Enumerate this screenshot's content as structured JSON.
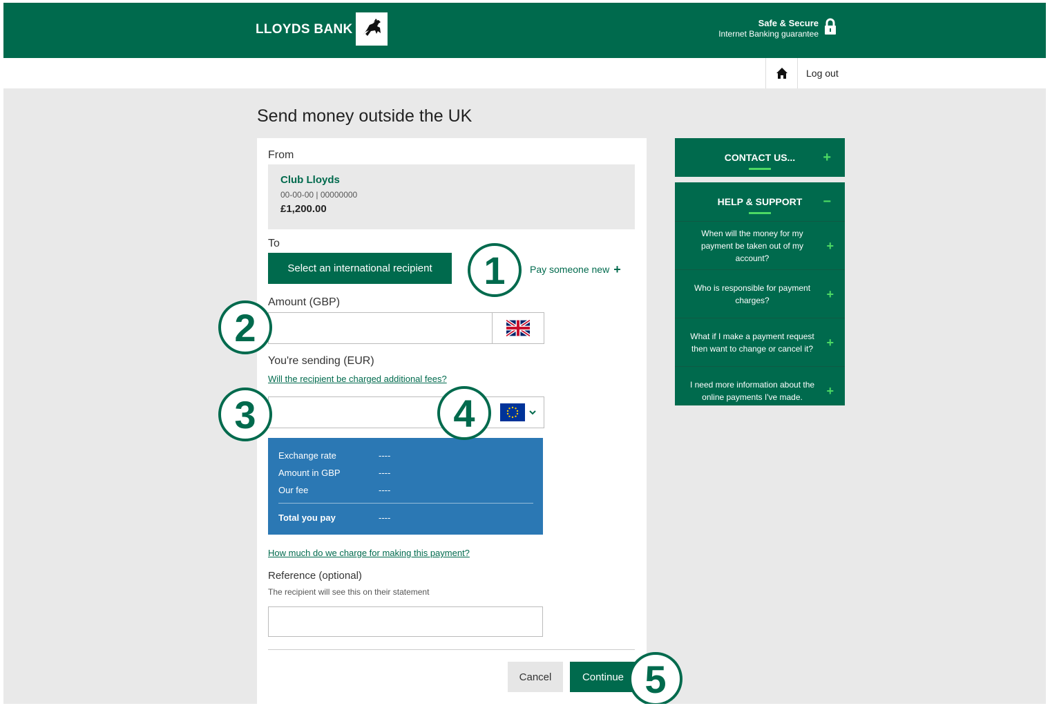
{
  "header": {
    "brand": "LLOYDS BANK",
    "secure_title": "Safe & Secure",
    "secure_subtitle": "Internet Banking guarantee"
  },
  "utility": {
    "logout_label": "Log out"
  },
  "page": {
    "title": "Send money outside the UK"
  },
  "form": {
    "from_label": "From",
    "account": {
      "name": "Club Lloyds",
      "number": "00-00-00 | 00000000",
      "balance": "£1,200.00"
    },
    "to_label": "To",
    "select_recipient_label": "Select an international recipient",
    "pay_new_label": "Pay someone new",
    "amount_label": "Amount (GBP)",
    "sending_label": "You're sending (EUR)",
    "fees_link": "Will the recipient be charged additional fees?",
    "fx": {
      "rows": [
        {
          "label": "Exchange rate",
          "value": "----"
        },
        {
          "label": "Amount in GBP",
          "value": "----"
        },
        {
          "label": "Our fee",
          "value": "----"
        }
      ],
      "total_label": "Total you pay",
      "total_value": "----"
    },
    "charge_link": "How much do we charge for making this payment?",
    "reference_label": "Reference (optional)",
    "reference_sub": "The recipient will see this on their statement",
    "cancel_label": "Cancel",
    "continue_label": "Continue"
  },
  "sidebar": {
    "contact_title": "CONTACT US...",
    "help_title": "HELP & SUPPORT",
    "faqs": [
      "When will the money for my payment be taken out of my account?",
      "Who is responsible for payment charges?",
      "What if I make a payment request then want to change or cancel it?",
      "I need more information about the online payments I've made."
    ]
  },
  "callouts": [
    "1",
    "2",
    "3",
    "4",
    "5"
  ],
  "colors": {
    "brand_green": "#006a4d",
    "fx_blue": "#2b78b4",
    "accent_green": "#4cd964"
  }
}
